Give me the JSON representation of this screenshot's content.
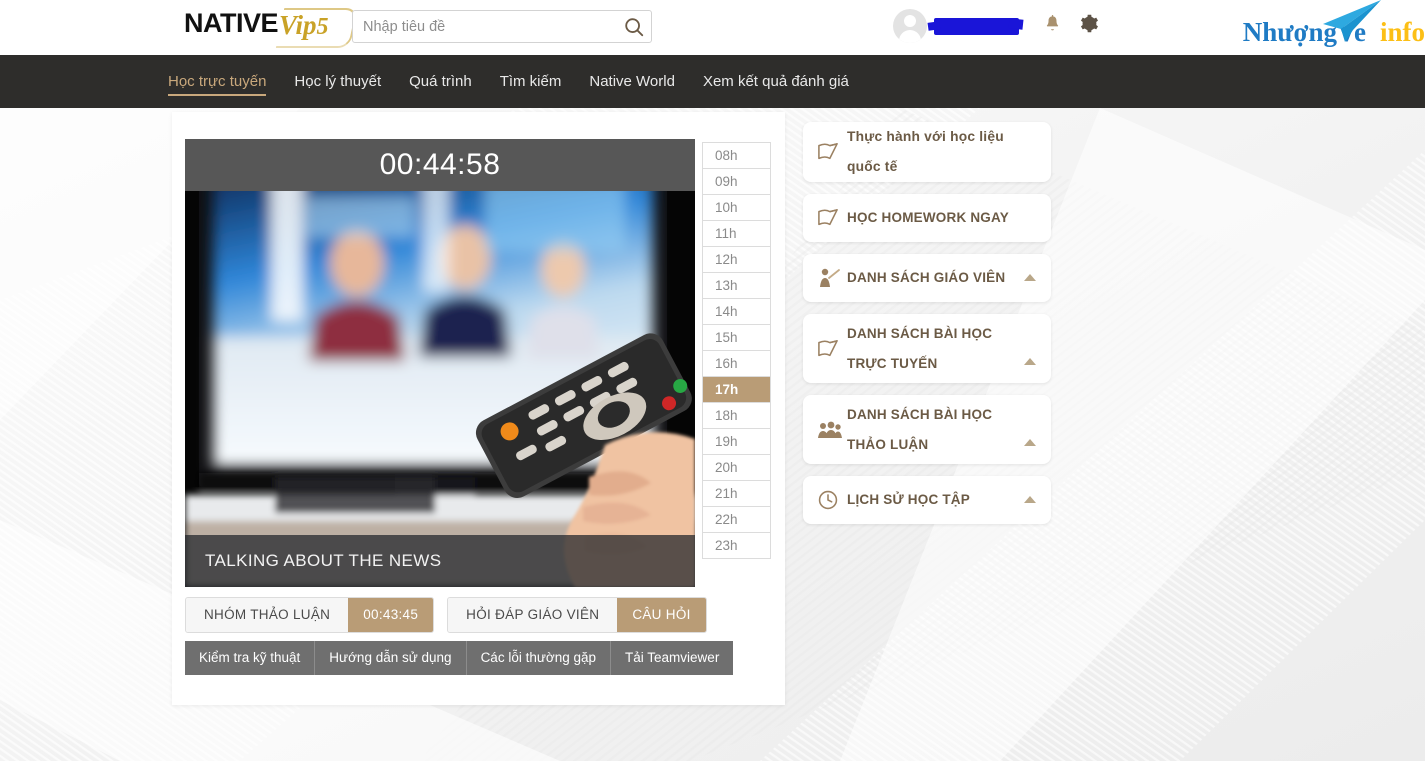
{
  "header": {
    "logo_main": "NATIVE",
    "logo_sub": "Vip",
    "logo_num": "5",
    "search": {
      "placeholder": "Nhập tiêu đề",
      "value": "",
      "icon": "search-icon"
    },
    "avatar_icon": "user-avatar-icon",
    "username_redacted": "",
    "bell_icon": "bell-icon",
    "gear_icon": "gear-icon",
    "watermark": {
      "text1": "NhượngVe",
      "text2": "info",
      "plane_icon": "paper-plane-icon"
    }
  },
  "nav": {
    "items": [
      {
        "label": "Học trực tuyến",
        "active": true
      },
      {
        "label": "Học lý thuyết",
        "active": false
      },
      {
        "label": "Quá trình",
        "active": false
      },
      {
        "label": "Tìm kiếm",
        "active": false
      },
      {
        "label": "Native World",
        "active": false
      },
      {
        "label": "Xem kết quả đánh giá",
        "active": false
      }
    ]
  },
  "player": {
    "timer": "00:44:58",
    "title": "TALKING ABOUT THE NEWS",
    "photo_alt": "hand-holding-tv-remote-pointed-at-blurred-news-broadcast"
  },
  "hours": {
    "items": [
      "08h",
      "09h",
      "10h",
      "11h",
      "12h",
      "13h",
      "14h",
      "15h",
      "16h",
      "17h",
      "18h",
      "19h",
      "20h",
      "21h",
      "22h",
      "23h"
    ],
    "selected": "17h"
  },
  "tabs": {
    "group1_label": "NHÓM THẢO LUẬN",
    "group1_accent": "00:43:45",
    "group2_label": "HỎI ĐÁP GIÁO VIÊN",
    "group2_accent": "CÂU HỎI"
  },
  "utilities": [
    "Kiểm tra kỹ thuật",
    "Hướng dẫn sử dụng",
    "Các lỗi thường gặp",
    "Tải Teamviewer"
  ],
  "sidebar": {
    "items": [
      {
        "label": "Thực hành với học liệu quốc tế",
        "icon": "book-icon",
        "chevron": false,
        "tall": false
      },
      {
        "label": "HỌC HOMEWORK NGAY",
        "icon": "book-icon",
        "chevron": false,
        "tall": false
      },
      {
        "label": "DANH SÁCH GIÁO VIÊN",
        "icon": "teacher-icon",
        "chevron": true,
        "tall": false
      },
      {
        "label": "DANH SÁCH BÀI HỌC TRỰC TUYẾN",
        "icon": "book-icon",
        "chevron": true,
        "tall": true
      },
      {
        "label": "DANH SÁCH BÀI HỌC THẢO LUẬN",
        "icon": "group-icon",
        "chevron": true,
        "tall": true
      },
      {
        "label": "LỊCH SỬ HỌC TẬP",
        "icon": "clock-icon",
        "chevron": true,
        "tall": false
      }
    ]
  },
  "colors": {
    "accent_tan": "#b99c76",
    "nav_dark": "#2e2d2b",
    "sidebar_text": "#6b5a45",
    "watermark_blue": "#1f7bc4",
    "watermark_yellow": "#fcbf16",
    "redaction_blue": "#1a15d8"
  }
}
